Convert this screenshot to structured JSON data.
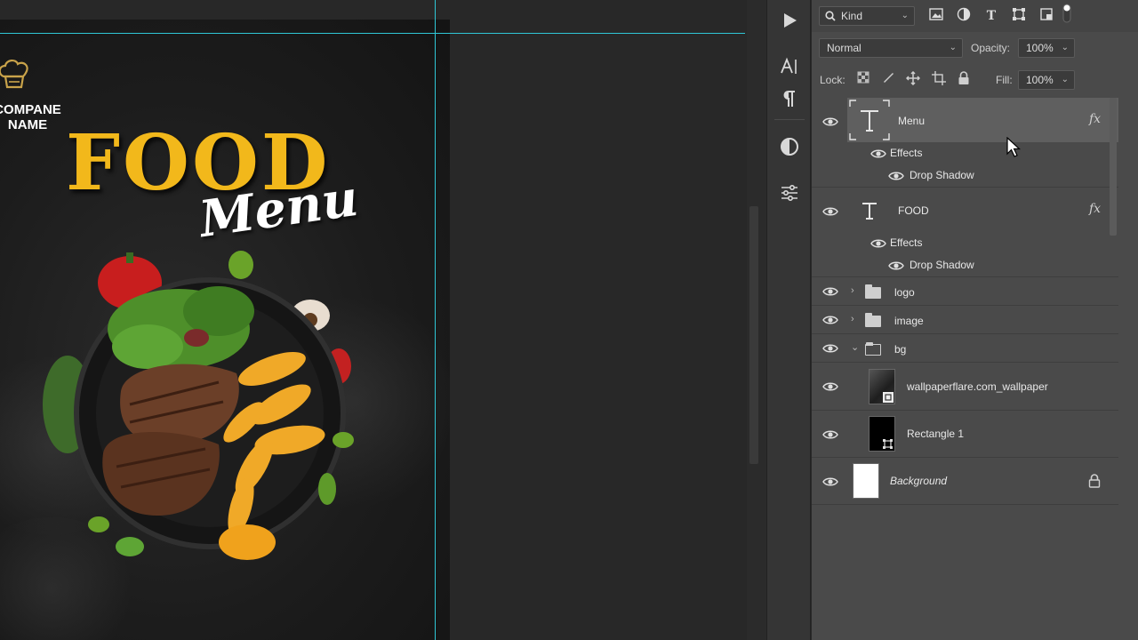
{
  "canvas": {
    "company_name_line1": "COMPANE",
    "company_name_line2": "NAME",
    "title_food": "FOOD",
    "title_menu": "Menu"
  },
  "tools": {
    "play_icon": "play-icon",
    "character_icon": "character-panel-icon",
    "paragraph_icon": "paragraph-panel-icon",
    "adjustments_icon": "adjustments-icon",
    "properties_icon": "properties-sliders-icon"
  },
  "layers_panel": {
    "filter_kind": "Kind",
    "blend_mode": "Normal",
    "opacity_label": "Opacity:",
    "opacity_value": "100%",
    "lock_label": "Lock:",
    "fill_label": "Fill:",
    "fill_value": "100%",
    "layers": [
      {
        "name": "Menu",
        "kind": "text",
        "selected": true,
        "has_fx": true,
        "effects_label": "Effects",
        "effect": "Drop Shadow"
      },
      {
        "name": "FOOD",
        "kind": "text",
        "selected": false,
        "has_fx": true,
        "effects_label": "Effects",
        "effect": "Drop Shadow"
      },
      {
        "name": "logo",
        "kind": "group",
        "expanded": false
      },
      {
        "name": "image",
        "kind": "group",
        "expanded": false
      },
      {
        "name": "bg",
        "kind": "group",
        "expanded": true
      },
      {
        "name": "wallpaperflare.com_wallpaper",
        "kind": "smart-object"
      },
      {
        "name": "Rectangle 1",
        "kind": "shape"
      },
      {
        "name": "Background",
        "kind": "background",
        "locked": true
      }
    ]
  },
  "colors": {
    "food_yellow": "#f2b81b",
    "guide_cyan": "#2fc7d6",
    "panel_bg": "#4a4a4a",
    "selected_row": "#5f5f5f"
  }
}
